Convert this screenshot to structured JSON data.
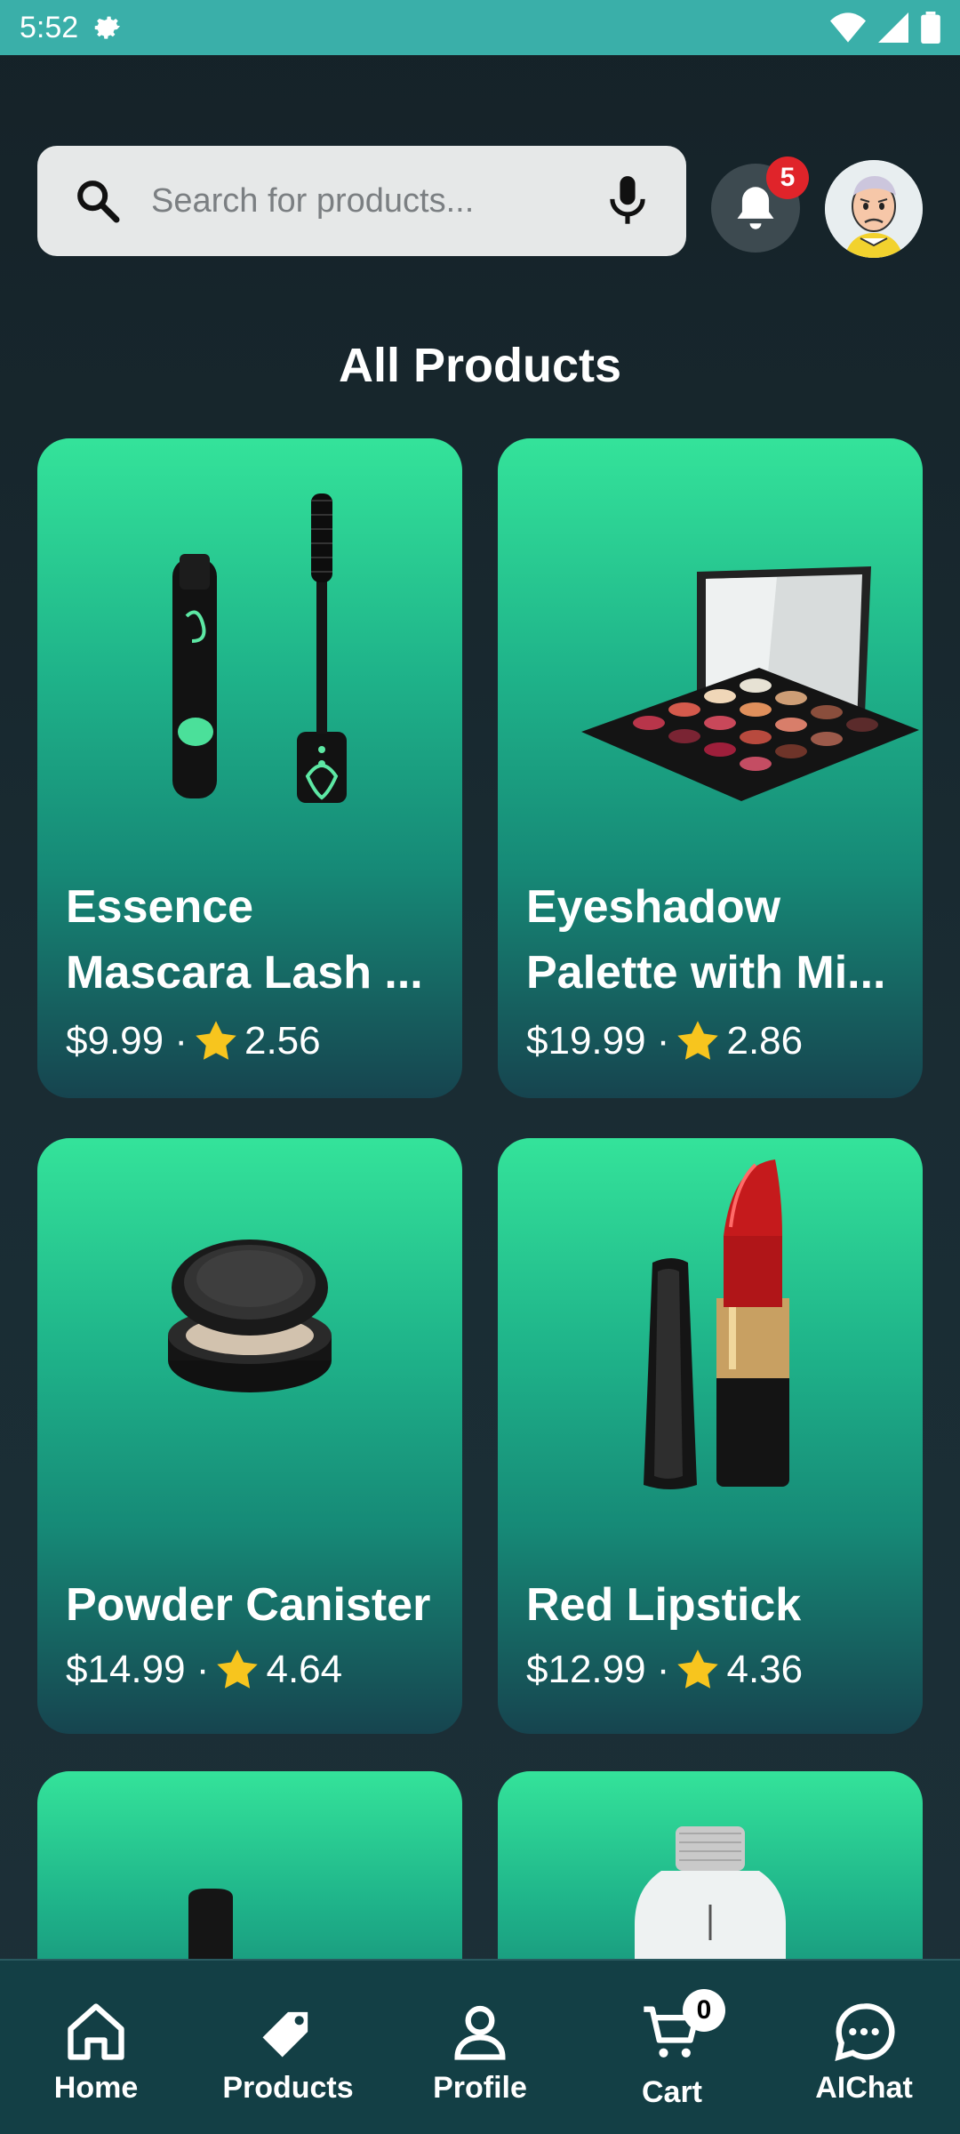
{
  "status_bar": {
    "time": "5:52"
  },
  "header": {
    "search_placeholder": "Search for products...",
    "notification_count": "5"
  },
  "page": {
    "title": "All Products"
  },
  "products": [
    {
      "name": "Essence Mascara Lash ...",
      "meta": "$9.99 · ",
      "rating": "2.56"
    },
    {
      "name": "Eyeshadow Palette with Mi...",
      "meta": "$19.99 · ",
      "rating": "2.86"
    },
    {
      "name": "Powder Canister",
      "meta": "$14.99 · ",
      "rating": "4.64"
    },
    {
      "name": "Red Lipstick",
      "meta": "$12.99 · ",
      "rating": "4.36"
    }
  ],
  "nav": {
    "items": [
      {
        "label": "Home",
        "icon": "home-icon"
      },
      {
        "label": "Products",
        "icon": "tag-icon"
      },
      {
        "label": "Profile",
        "icon": "person-icon"
      },
      {
        "label": "Cart",
        "icon": "cart-icon"
      },
      {
        "label": "AIChat",
        "icon": "chat-icon"
      }
    ],
    "cart_count": "0"
  },
  "colors": {
    "status_bar": "#3aafa9",
    "card_top": "#34e39a",
    "card_bottom": "#16444f",
    "nav_background": "#133f45",
    "badge": "#e0242a"
  }
}
